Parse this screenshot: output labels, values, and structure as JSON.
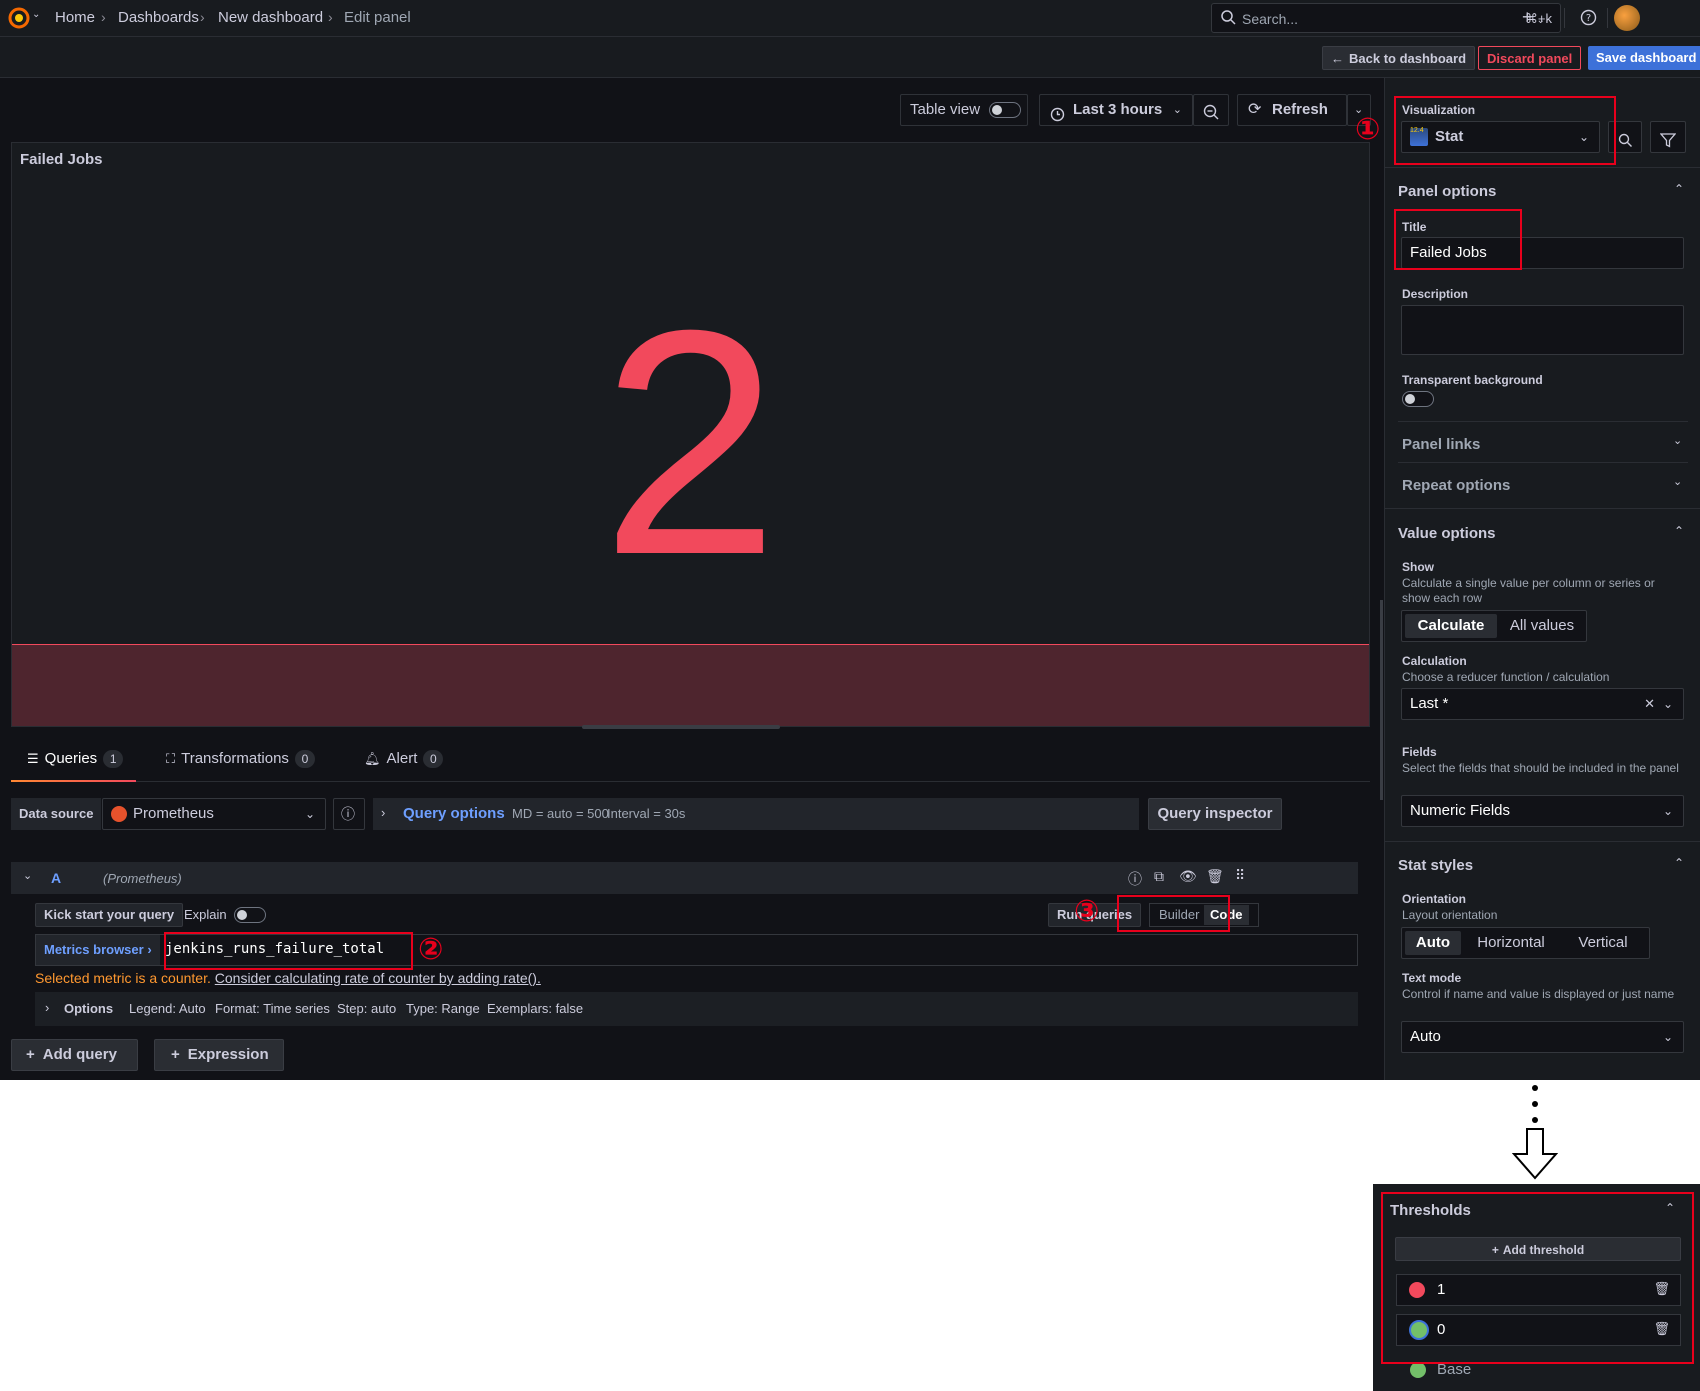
{
  "topnav": {
    "breadcrumbs": [
      "Home",
      "Dashboards",
      "New dashboard",
      "Edit panel"
    ],
    "search_placeholder": "Search...",
    "search_shortcut": "⌘+k"
  },
  "editbar": {
    "back_label": "Back to dashboard",
    "discard_label": "Discard panel",
    "save_label": "Save dashboard"
  },
  "panel_toolbar": {
    "table_view_label": "Table view",
    "time_range_label": "Last 3 hours",
    "refresh_label": "Refresh"
  },
  "panel": {
    "title": "Failed Jobs",
    "value": "2"
  },
  "query_tabs": [
    {
      "label": "Queries",
      "count": "1"
    },
    {
      "label": "Transformations",
      "count": "0"
    },
    {
      "label": "Alert",
      "count": "0"
    }
  ],
  "datasource": {
    "label": "Data source",
    "value": "Prometheus",
    "query_options_label": "Query options",
    "md_info": "MD = auto = 500",
    "interval_info": "Interval = 30s",
    "inspector_label": "Query inspector"
  },
  "query": {
    "ref_id": "A",
    "datasource_name": "(Prometheus)",
    "kickstart_label": "Kick start your query",
    "explain_label": "Explain",
    "run_label": "Run queries",
    "builder_label": "Builder",
    "code_label": "Code",
    "metrics_browser_label": "Metrics browser ›",
    "expression": "jenkins_runs_failure_total",
    "warning_text": "Selected metric is a counter.",
    "warning_link": "Consider calculating rate of counter by adding rate().",
    "options_label": "Options",
    "options_summary": [
      "Legend: Auto",
      "Format: Time series",
      "Step: auto",
      "Type: Range",
      "Exemplars: false"
    ]
  },
  "add_query_label": "Add query",
  "expression_label": "Expression",
  "sidebar": {
    "visualization_label": "Visualization",
    "visualization_value": "Stat",
    "visualization_badge": "12.4",
    "panel_options_title": "Panel options",
    "title_label": "Title",
    "title_value": "Failed Jobs",
    "description_label": "Description",
    "transparent_label": "Transparent background",
    "panel_links_label": "Panel links",
    "repeat_options_label": "Repeat options",
    "value_options_title": "Value options",
    "show_label": "Show",
    "show_desc": "Calculate a single value per column or series or show each row",
    "show_options": [
      "Calculate",
      "All values"
    ],
    "calculation_label": "Calculation",
    "calculation_desc": "Choose a reducer function / calculation",
    "calculation_value": "Last *",
    "fields_label": "Fields",
    "fields_desc": "Select the fields that should be included in the panel",
    "fields_value": "Numeric Fields",
    "stat_styles_title": "Stat styles",
    "orientation_label": "Orientation",
    "orientation_desc": "Layout orientation",
    "orientation_options": [
      "Auto",
      "Horizontal",
      "Vertical"
    ],
    "text_mode_label": "Text mode",
    "text_mode_desc": "Control if name and value is displayed or just name",
    "text_mode_value": "Auto"
  },
  "annotations": [
    "①",
    "②",
    "③"
  ],
  "thresholds": {
    "title": "Thresholds",
    "add_label": "Add threshold",
    "rows": [
      {
        "value": "1",
        "color": "#f2495c"
      },
      {
        "value": "0",
        "color": "#73bf69"
      }
    ],
    "base_label": "Base",
    "base_color": "#73bf69"
  }
}
